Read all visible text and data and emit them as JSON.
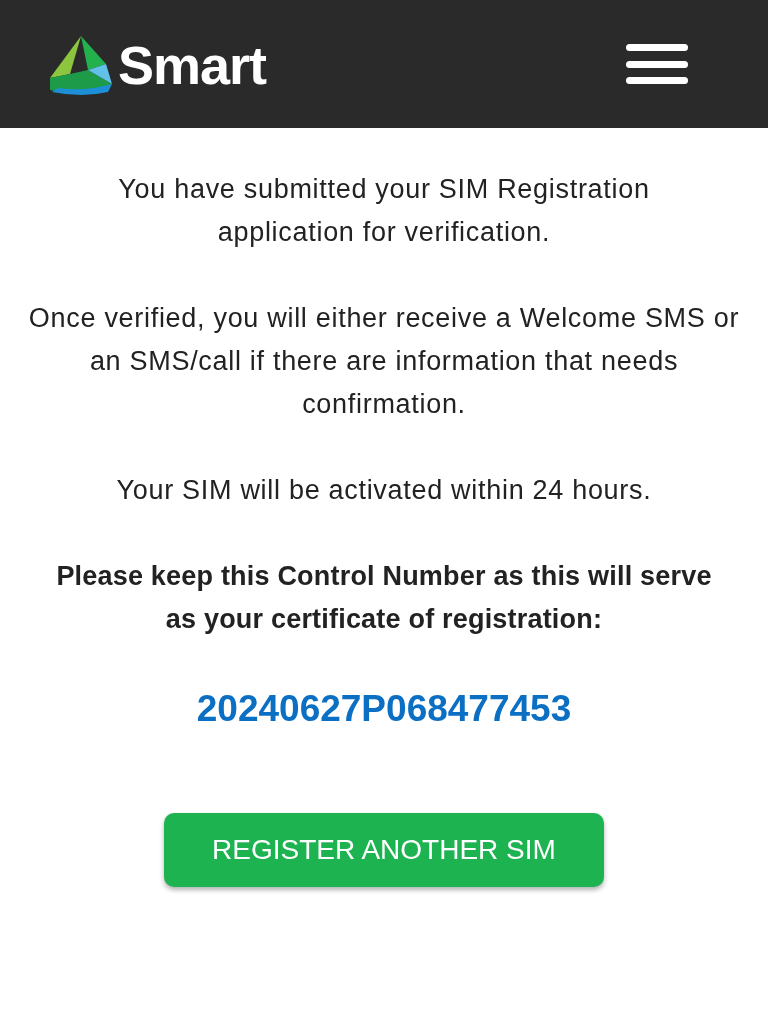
{
  "header": {
    "brand": "Smart"
  },
  "messages": [
    {
      "text": "You have submitted your SIM Registration application for verification.",
      "kind": "normal"
    },
    {
      "text": "Once verified, you will either receive a Welcome SMS or an SMS/call if there are information that needs confirmation.",
      "kind": "normal"
    },
    {
      "text": "Your SIM will be activated within 24 hours.",
      "kind": "normal"
    },
    {
      "text": "Please keep this Control Number as this will serve as your certificate of registration:",
      "kind": "bold"
    }
  ],
  "control_number": "20240627P068477453",
  "button": "REGISTER ANOTHER SIM"
}
